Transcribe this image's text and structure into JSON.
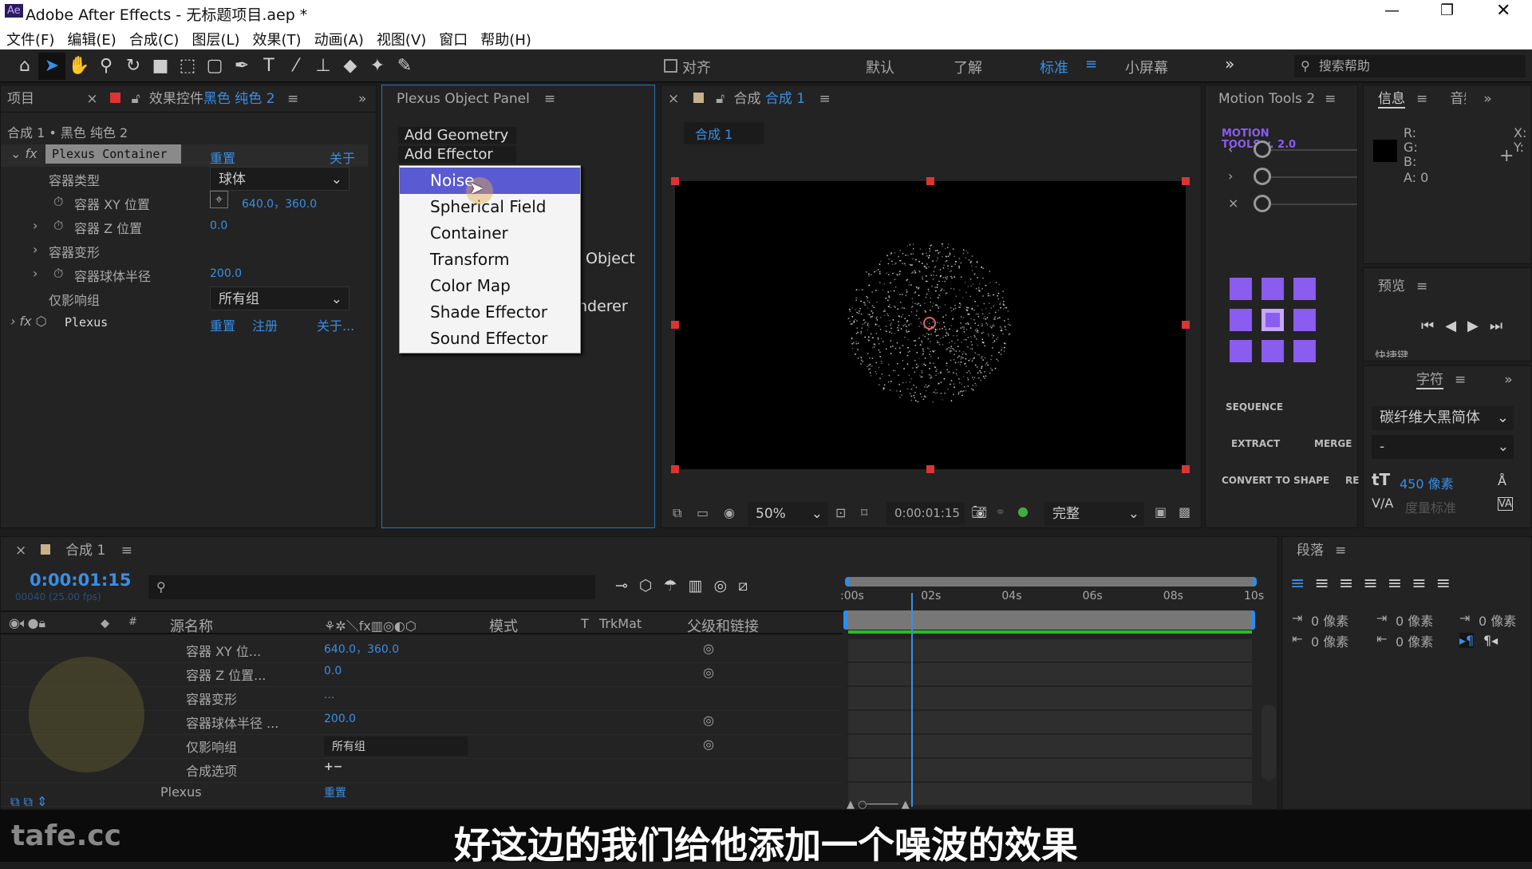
{
  "window": {
    "title": "Adobe After Effects - 无标题项目.aep *",
    "app_icon": "Ae",
    "controls": [
      "minimize-icon",
      "restore-icon",
      "close-icon"
    ]
  },
  "menu": [
    "文件(F)",
    "编辑(E)",
    "合成(C)",
    "图层(L)",
    "效果(T)",
    "动画(A)",
    "视图(V)",
    "窗口",
    "帮助(H)"
  ],
  "toolbar": {
    "snap_label": "对齐",
    "workspaces": [
      "默认",
      "了解",
      "标准",
      "小屏幕"
    ],
    "active_workspace": "标准",
    "search_placeholder": "搜索帮助"
  },
  "effect_controls": {
    "tab_project": "项目",
    "tab_label": "效果控件",
    "tab_layer": "黑色 纯色 2",
    "breadcrumb": "合成 1 • 黑色 纯色 2",
    "effects": [
      {
        "name": "Plexus Container",
        "reset": "重置",
        "about": "关于"
      },
      {
        "name": "Plexus",
        "reset": "重置",
        "register": "注册",
        "about": "关于..."
      }
    ],
    "props": [
      {
        "label": "容器类型",
        "value": "球体"
      },
      {
        "label": "容器 XY 位置",
        "value": "640.0，360.0"
      },
      {
        "label": "容器 Z 位置",
        "value": "0.0"
      },
      {
        "label": "容器变形",
        "value": ""
      },
      {
        "label": "容器球体半径",
        "value": "200.0"
      },
      {
        "label": "仅影响组",
        "value": "所有组"
      }
    ]
  },
  "plexus_panel": {
    "title": "Plexus Object Panel",
    "add_geometry": "Add Geometry",
    "add_effector": "Add Effector",
    "behind_text1": "Object",
    "behind_text2": "nderer",
    "menu_items": [
      "Noise",
      "Spherical Field",
      "Container",
      "Transform",
      "Color Map",
      "Shade Effector",
      "Sound Effector"
    ],
    "highlighted": "Noise",
    "highlight_color": "#5a5ad2"
  },
  "composition": {
    "tab_prefix": "合成",
    "tab_name": "合成 1",
    "breadcrumb": "合成 1",
    "zoom": "50%",
    "timecode": "0:00:01:15",
    "resolution": "完整"
  },
  "motion_tools": {
    "title": "Motion Tools 2",
    "logo": "MOTION TOOLS v. 2.0",
    "sequence": "SEQUENCE",
    "extract": "EXTRACT",
    "merge": "MERGE",
    "convert": "CONVERT TO SHAPE",
    "re": "RE",
    "accent": "#8a5cf0"
  },
  "info": {
    "tab": "信息",
    "tab2": "音频",
    "r": "R:",
    "g": "G:",
    "b": "B:",
    "a": "A: 0",
    "x": "X:",
    "y": "Y:"
  },
  "preview": {
    "title": "预览",
    "shortcut": "快捷键"
  },
  "character": {
    "title": "字符",
    "font": "碳纤维大黑简体",
    "style": "-",
    "size": "450 像素",
    "kerning": "度量标准"
  },
  "timeline": {
    "tab": "合成 1",
    "timecode": "0:00:01:15",
    "frame_info": "00040 (25.00 fps)",
    "columns": {
      "source": "源名称",
      "mode": "模式",
      "t": "T",
      "trkmat": "TrkMat",
      "parent": "父级和链接"
    },
    "ruler": [
      ":00s",
      "02s",
      "04s",
      "06s",
      "08s",
      "10s"
    ],
    "playhead_seconds": 1.6,
    "rows": [
      {
        "label": "容器 XY 位...",
        "value": "640.0，360.0"
      },
      {
        "label": "容器 Z 位置...",
        "value": "0.0"
      },
      {
        "label": "容器变形",
        "value": "..."
      },
      {
        "label": "容器球体半径 ...",
        "value": "200.0"
      },
      {
        "label": "仅影响组",
        "value": "所有组"
      },
      {
        "label": "合成选项",
        "value": "+−"
      },
      {
        "label": "Plexus",
        "value": "重置",
        "extra": "..."
      }
    ]
  },
  "paragraph": {
    "title": "段落",
    "values": [
      "0 像素",
      "0 像素",
      "0 像素",
      "0 像素",
      "0 像素"
    ]
  },
  "subtitle": "好这边的我们给他添加一个噪波的效果",
  "watermark": "tafe.cc"
}
